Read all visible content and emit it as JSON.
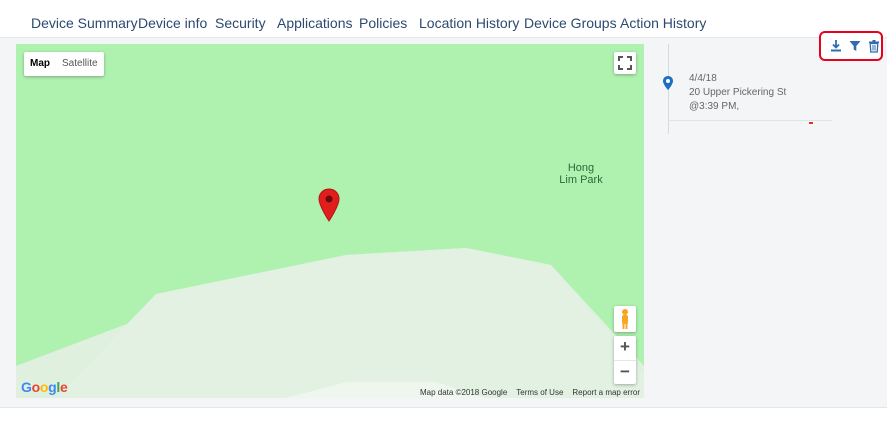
{
  "tabs": [
    {
      "label": "Device Summary"
    },
    {
      "label": "Device info"
    },
    {
      "label": "Security"
    },
    {
      "label": "Applications"
    },
    {
      "label": "Policies"
    },
    {
      "label": "Location History",
      "active": true
    },
    {
      "label": "Device Groups"
    },
    {
      "label": "Action History"
    }
  ],
  "map": {
    "map_type_options": [
      "Map",
      "Satellite"
    ],
    "selected_map_type": "Map",
    "place_label_line1": "Hong",
    "place_label_line2": "Lim Park",
    "zoom_in_label": "+",
    "zoom_out_label": "−",
    "logo_text": "Google",
    "attribution": {
      "map_data": "Map data ©2018 Google",
      "terms": "Terms of Use",
      "report": "Report a map error"
    }
  },
  "history": {
    "items": [
      {
        "date": "4/4/18",
        "address": "20 Upper Pickering St",
        "time": "@3:39 PM,"
      }
    ]
  },
  "colors": {
    "tab_text": "#2b4a6f",
    "tab_active_underline": "#1f6fc0",
    "map_green": "#aff2b0",
    "map_light": "#dff0df",
    "marker_red": "#e01e1e",
    "toolbar_highlight": "#e8001e",
    "toolbar_icon": "#2f6db0"
  },
  "icons": [
    "download-icon",
    "filter-icon",
    "trash-icon",
    "location-pin-icon",
    "fullscreen-icon",
    "pegman-icon",
    "map-marker-icon"
  ]
}
